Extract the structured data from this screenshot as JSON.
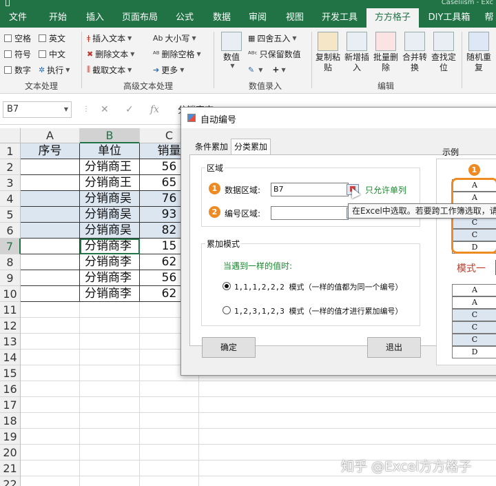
{
  "app": {
    "title_partial": "Caseliism - Exc"
  },
  "ribbon_tabs": [
    "文件",
    "开始",
    "插入",
    "页面布局",
    "公式",
    "数据",
    "审阅",
    "视图",
    "开发工具",
    "方方格子",
    "DIY工具箱",
    "帮"
  ],
  "ribbon": {
    "text_group": {
      "label": "文本处理",
      "checkboxes": [
        "空格",
        "英文",
        "符号",
        "中文",
        "数字"
      ],
      "execute": "执行"
    },
    "advanced_group": {
      "label": "高级文本处理",
      "items": [
        "插入文本",
        "删除文本",
        "截取文本",
        "大小写",
        "删除空格",
        "更多"
      ]
    },
    "numeric_group": {
      "label": "数值录入",
      "big": "数值",
      "items": [
        "四舍五入",
        "只保留数值"
      ]
    },
    "edit_group": {
      "label": "编辑",
      "buttons": [
        {
          "l1": "复制粘",
          "l2": "贴"
        },
        {
          "l1": "新增插",
          "l2": "入"
        },
        {
          "l1": "批量删",
          "l2": "除"
        },
        {
          "l1": "合并转",
          "l2": "换"
        },
        {
          "l1": "查找定",
          "l2": "位"
        }
      ]
    },
    "random_btn": {
      "l1": "随机重",
      "l2": "复"
    }
  },
  "formula_bar": {
    "name_box": "B7",
    "formula": "分销商李"
  },
  "grid": {
    "columns": [
      "A",
      "B",
      "C"
    ],
    "rows": [
      "1",
      "2",
      "3",
      "4",
      "5",
      "6",
      "7",
      "8",
      "9",
      "10",
      "11",
      "12",
      "13",
      "14",
      "15",
      "16",
      "17",
      "18",
      "19",
      "20",
      "21",
      "22"
    ],
    "header": {
      "a": "序号",
      "b": "单位",
      "c": "销量"
    },
    "data": [
      {
        "b": "分销商王",
        "c": "56"
      },
      {
        "b": "分销商王",
        "c": "65"
      },
      {
        "b": "分销商吴",
        "c": "76"
      },
      {
        "b": "分销商吴",
        "c": "93"
      },
      {
        "b": "分销商吴",
        "c": "82"
      },
      {
        "b": "分销商李",
        "c": "15"
      },
      {
        "b": "分销商李",
        "c": "62"
      },
      {
        "b": "分销商李",
        "c": "56"
      },
      {
        "b": "分销商李",
        "c": "62"
      }
    ]
  },
  "dialog": {
    "title": "自动编号",
    "tabs": [
      "条件累加",
      "分类累加"
    ],
    "region_legend": "区域",
    "data_region_badge": "1",
    "data_region_label": "数据区域:",
    "data_region_value": "B7",
    "single_col_note": "只允许单列",
    "number_region_badge": "2",
    "number_region_label": "编号区域:",
    "number_region_value": "",
    "mode_legend": "累加模式",
    "same_value_prompt": "当遇到一样的值时:",
    "option1": "1,1,1,2,2,2 模式（一样的值都为同一个编号）",
    "option2": "1,2,3,1,2,3 模式（一样的值才进行累加编号）",
    "ok": "确定",
    "exit": "退出",
    "tooltip": "在Excel中选取。若要跨工作簿选取，请",
    "example_label": "示例",
    "example_badge": "1",
    "example_top": [
      "A",
      "A",
      "C",
      "C",
      "C",
      "D"
    ],
    "mode_one": "模式一",
    "example_bottom": [
      "A",
      "A",
      "C",
      "C",
      "C",
      "D"
    ]
  },
  "watermark": "知乎 @Excel方方格子",
  "colors": {
    "excel_green": "#217346",
    "header_blue": "#dce6f1",
    "badge_orange": "#ee8a22",
    "note_green": "#1a8a2e"
  }
}
